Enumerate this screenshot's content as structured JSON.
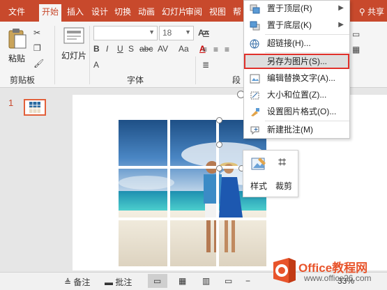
{
  "tabs": [
    "文件",
    "开始",
    "插入",
    "设计",
    "切换",
    "动画",
    "幻灯片",
    "审阅",
    "视图",
    "帮"
  ],
  "active_tab": "开始",
  "share_label": "共享",
  "ribbon": {
    "paste_label": "粘贴",
    "new_slide_label": "幻灯片",
    "clipboard_label": "剪贴板",
    "font_label": "字体",
    "paragraph_label": "段",
    "font_size_value": "18",
    "bold": "B",
    "italic": "I",
    "underline": "U",
    "strike": "S",
    "abc": "abc",
    "av": "AV",
    "aa": "Aa",
    "font_color": "A"
  },
  "slide_number": "1",
  "context_menu": {
    "items": [
      {
        "label": "置于顶层(R)",
        "has_submenu": true
      },
      {
        "label": "置于底层(K)",
        "has_submenu": true
      },
      {
        "label": "超链接(H)...",
        "has_submenu": false
      },
      {
        "label": "另存为图片(S)...",
        "has_submenu": false,
        "highlighted": true
      },
      {
        "label": "编辑替换文字(A)...",
        "has_submenu": false
      },
      {
        "label": "大小和位置(Z)...",
        "has_submenu": false
      },
      {
        "label": "设置图片格式(O)...",
        "has_submenu": false
      },
      {
        "label": "新建批注(M)",
        "has_submenu": false
      }
    ]
  },
  "mini_toolbar": {
    "style_label": "样式",
    "crop_label": "裁剪"
  },
  "statusbar": {
    "notes_label": "备注",
    "comments_label": "批注",
    "zoom": "33%"
  },
  "watermark": {
    "brand": "Office教程网",
    "url": "www.office26.com"
  },
  "colors": {
    "accent": "#c8492c",
    "highlight_border": "#e0302a"
  }
}
